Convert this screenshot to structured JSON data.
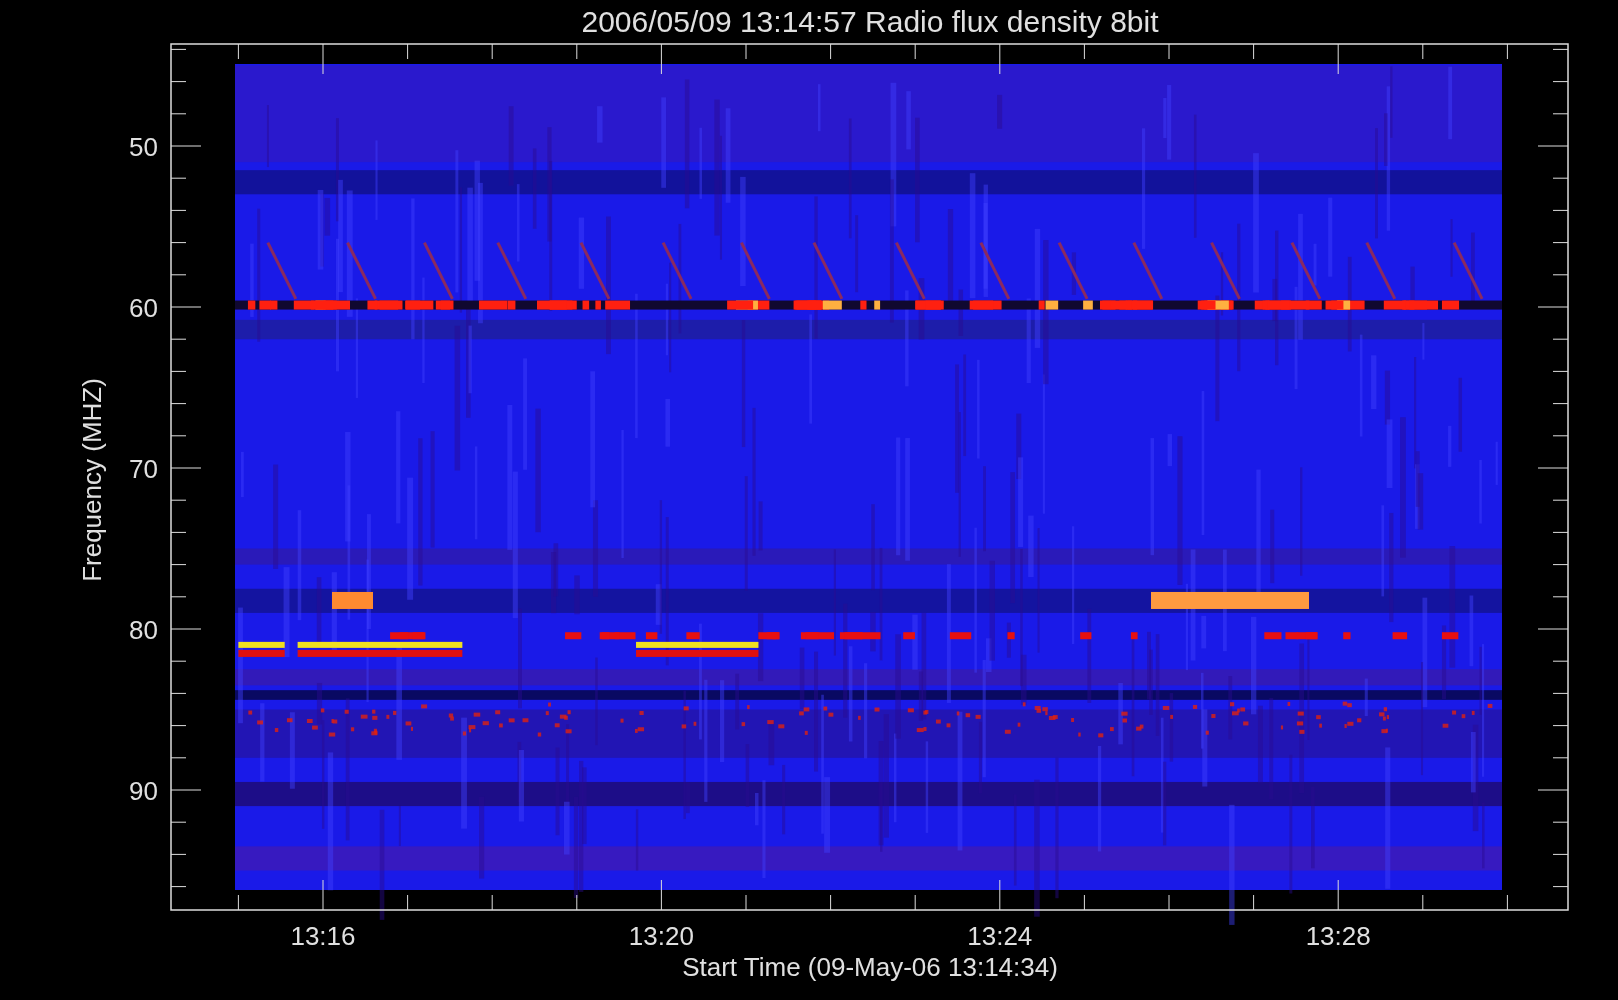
{
  "title": "2006/05/09 13:14:57 Radio flux density 8bit",
  "y_axis": {
    "label": "Frequency (MHZ)",
    "ticks": [
      "50",
      "60",
      "70",
      "80",
      "90"
    ]
  },
  "x_axis": {
    "label": "Start Time (09-May-06 13:14:34)",
    "ticks": [
      "13:16",
      "13:20",
      "13:24",
      "13:28"
    ]
  }
}
